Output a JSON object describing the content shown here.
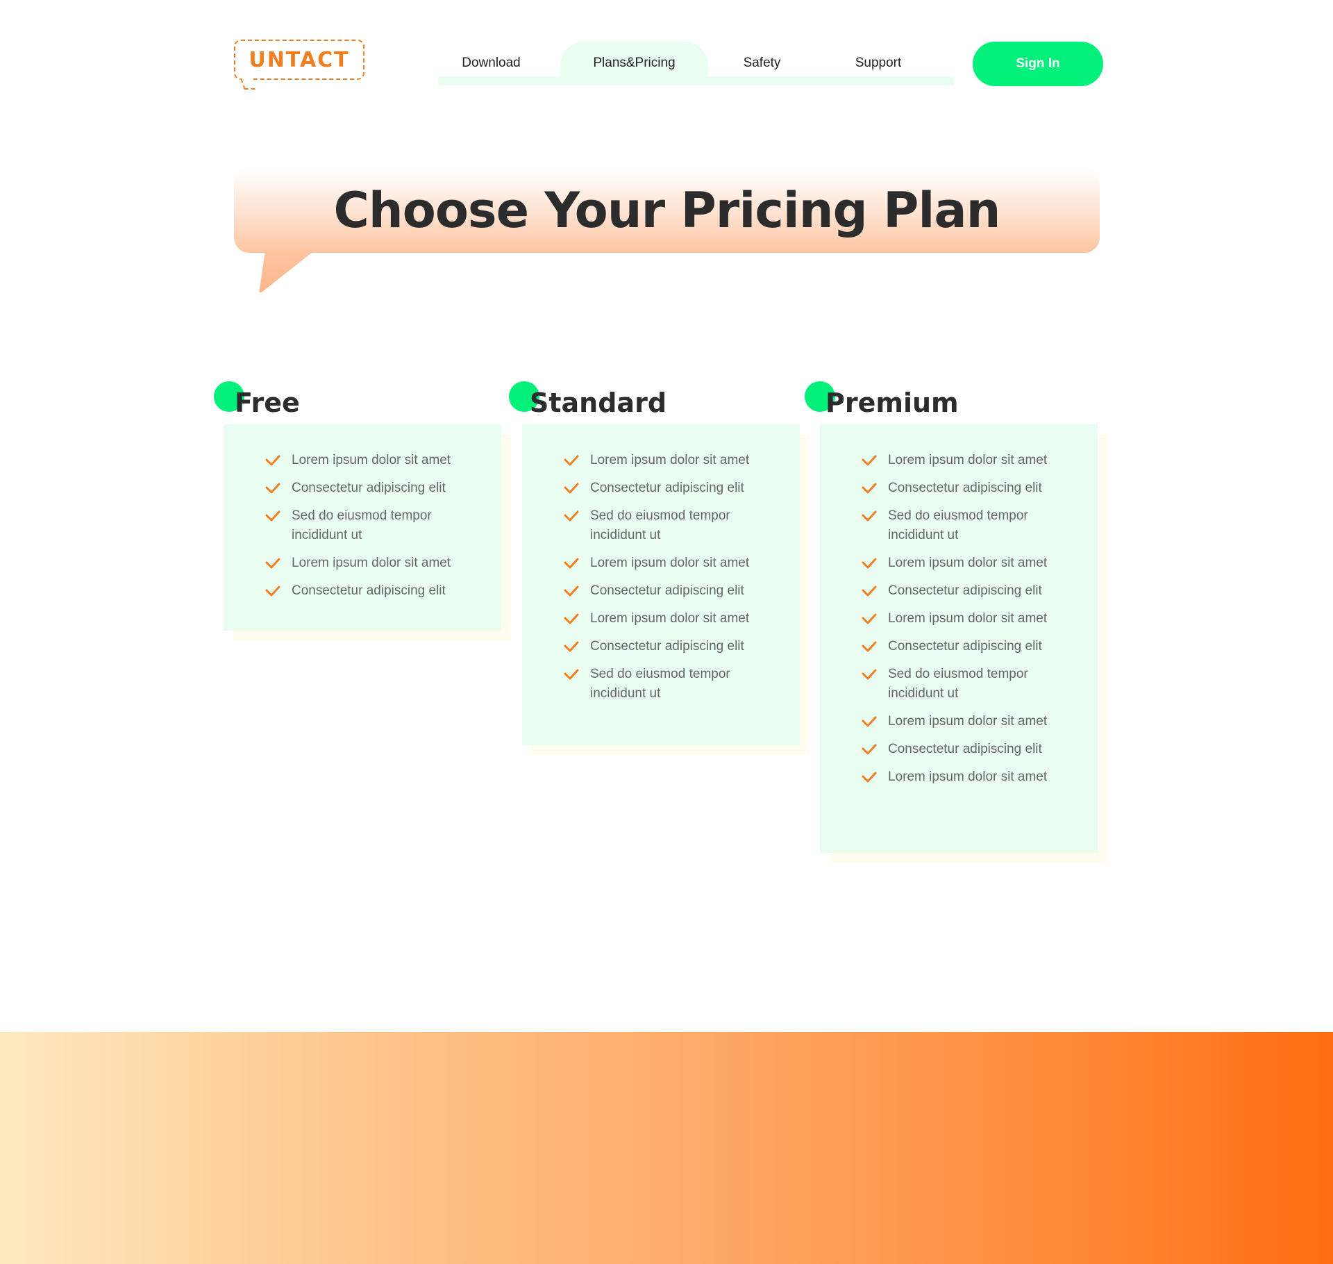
{
  "brand": {
    "logo_text": "UNTACT",
    "accent": "#f07f22",
    "mint": "#00f07a",
    "mint_light": "#e9fdf1"
  },
  "nav": {
    "items": [
      {
        "label": "Download"
      },
      {
        "label": "Plans&Pricing",
        "active": true
      },
      {
        "label": "Safety"
      },
      {
        "label": "Support"
      }
    ],
    "signin_label": "Sign In"
  },
  "hero": {
    "title": "Choose Your Pricing Plan"
  },
  "plans": [
    {
      "name": "Free",
      "features": [
        "Lorem ipsum dolor sit amet",
        "Consectetur adipiscing elit",
        "Sed do eiusmod tempor incididunt ut",
        "Lorem ipsum dolor sit amet",
        "Consectetur adipiscing elit"
      ]
    },
    {
      "name": "Standard",
      "features": [
        "Lorem ipsum dolor sit amet",
        "Consectetur adipiscing elit",
        "Sed do eiusmod tempor incididunt ut",
        "Lorem ipsum dolor sit amet",
        "Consectetur adipiscing elit",
        "Lorem ipsum dolor sit amet",
        "Consectetur adipiscing elit",
        "Sed do eiusmod tempor incididunt ut"
      ]
    },
    {
      "name": "Premium",
      "features": [
        "Lorem ipsum dolor sit amet",
        "Consectetur adipiscing elit",
        "Sed do eiusmod tempor incididunt ut",
        "Lorem ipsum dolor sit amet",
        "Consectetur adipiscing elit",
        "Lorem ipsum dolor sit amet",
        "Consectetur adipiscing elit",
        "Sed do eiusmod tempor incididunt ut",
        "Lorem ipsum dolor sit amet",
        "Consectetur adipiscing elit",
        "Lorem ipsum dolor sit amet"
      ]
    }
  ]
}
